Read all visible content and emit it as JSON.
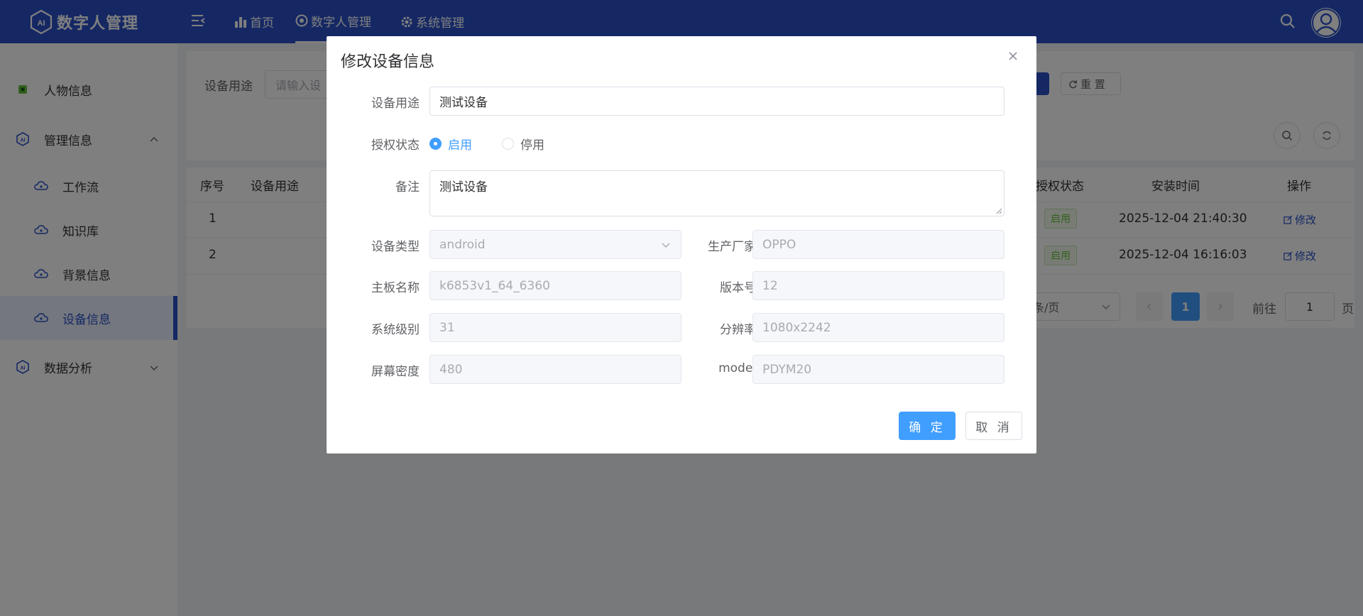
{
  "app": {
    "title": "数字人管理"
  },
  "topnav": [
    {
      "label": "首页"
    },
    {
      "label": "数字人管理"
    },
    {
      "label": "系统管理"
    }
  ],
  "sidebar": {
    "items": [
      {
        "label": "人物信息"
      },
      {
        "label": "管理信息"
      },
      {
        "label": "工作流"
      },
      {
        "label": "知识库"
      },
      {
        "label": "背景信息"
      },
      {
        "label": "设备信息"
      },
      {
        "label": "数据分析"
      }
    ]
  },
  "search": {
    "label": "设备用途",
    "placeholder": "请输入设",
    "reset_label": "重 置"
  },
  "table": {
    "headers": [
      "序号",
      "设备用途",
      "授权状态",
      "安装时间",
      "操作"
    ],
    "rows": [
      {
        "index": "1",
        "status": "启用",
        "time": "2025-12-04 21:40:30",
        "action": "修改"
      },
      {
        "index": "2",
        "status": "启用",
        "time": "2025-12-04 16:16:03",
        "action": "修改"
      }
    ]
  },
  "pagination": {
    "page_size": "条/页",
    "current": "1",
    "goto_label": "前往",
    "goto_value": "1",
    "page_unit": "页"
  },
  "dialog": {
    "title": "修改设备信息",
    "purpose": {
      "label": "设备用途",
      "value": "测试设备"
    },
    "auth": {
      "label": "授权状态",
      "options": [
        "启用",
        "停用"
      ],
      "selected": "启用"
    },
    "remark": {
      "label": "备注",
      "value": "测试设备"
    },
    "device_type": {
      "label": "设备类型",
      "value": "android"
    },
    "manufacturer": {
      "label": "生产厂家",
      "value": "OPPO"
    },
    "board": {
      "label": "主板名称",
      "value": "k6853v1_64_6360"
    },
    "version": {
      "label": "版本号",
      "value": "12"
    },
    "sys_level": {
      "label": "系统级别",
      "value": "31"
    },
    "resolution": {
      "label": "分辨率",
      "value": "1080x2242"
    },
    "density": {
      "label": "屏幕密度",
      "value": "480"
    },
    "model": {
      "label": "model",
      "value": "PDYM20"
    },
    "confirm_label": "确 定",
    "cancel_label": "取 消"
  },
  "colors": {
    "primary": "#2b50c8",
    "accent": "#409eff",
    "success": "#67c23a"
  }
}
